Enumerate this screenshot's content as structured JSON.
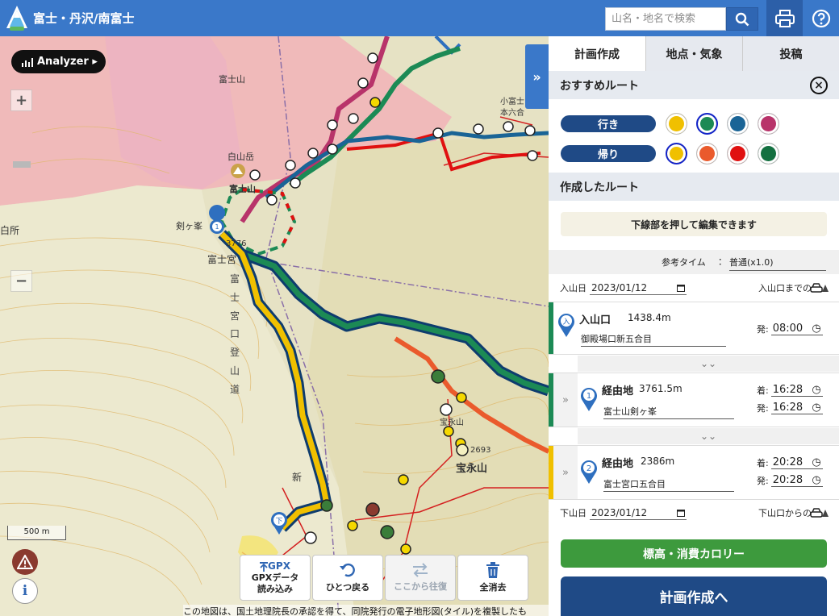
{
  "header": {
    "title": "富士・丹沢/南富士",
    "search_placeholder": "山名・地名で検索",
    "logo_icon": "mountain-logo-icon",
    "search_icon": "search-icon",
    "print_icon": "printer-icon",
    "help_icon": "help-icon",
    "color": "#3a78c9"
  },
  "map": {
    "analyzer_label": "Analyzer ▸",
    "zoom_in": "+",
    "zoom_out": "−",
    "scale": "500 m",
    "info_label": "i",
    "collapse_label": "»",
    "labels": {
      "fuji_1": "富士山",
      "fuji_2": "富士山",
      "hakusan": "白山岳",
      "kengamine": "剣ヶ峯",
      "elev_3776": "3776",
      "fujinomiya": "富士宮",
      "shirasho": "白所",
      "hoeizan": "宝永山",
      "hoeizan_small": "宝永山",
      "elev_2693": "2693",
      "motorokugo": "本六合",
      "kofuji": "小富士",
      "trail_vertical": "富士宮口登山道",
      "trail_tail": "新"
    },
    "toolbar": [
      {
        "icon": "upload-icon",
        "top": "GPX",
        "label": "GPXデータ\n読み込み",
        "enabled": true
      },
      {
        "icon": "undo-icon",
        "label": "ひとつ戻る",
        "enabled": true
      },
      {
        "icon": "swap-icon",
        "label": "ここから往復",
        "enabled": false
      },
      {
        "icon": "trash-icon",
        "label": "全消去",
        "enabled": true
      }
    ],
    "copyright": "この地図は、国土地理院長の承認を得て、同院発行の電子地形図(タイル)を複製したも"
  },
  "panel": {
    "tabs": [
      "計画作成",
      "地点・気象",
      "投稿"
    ],
    "active_tab": 0,
    "recommended": {
      "title": "おすすめルート",
      "outbound_label": "行き",
      "return_label": "帰り",
      "outbound_colors": [
        "#f0c000",
        "#1c8a55",
        "#1a6496",
        "#b8336a"
      ],
      "return_colors": [
        "#f0c000",
        "#ea5a2c",
        "#e01010",
        "#137040"
      ],
      "outbound_selected": 1,
      "return_selected": 0
    },
    "created": {
      "title": "作成したルート",
      "hint": "下線部を押して編集できます",
      "ref_time_label": "参考タイム",
      "ref_time_sep": "：",
      "ref_time_value": "普通(x1.0)"
    },
    "start_date": {
      "label": "入山日",
      "value": "2023/01/12",
      "access": "入山口までの"
    },
    "end_date": {
      "label": "下山日",
      "value": "2023/01/12",
      "access": "下山口からの"
    },
    "points": [
      {
        "badge": "入",
        "name": "入山口",
        "elev": "1438.4m",
        "place": "御殿場口新五合目",
        "depart_label": "発:",
        "depart": "08:00",
        "bar": "#1c8a55"
      },
      {
        "badge": "1",
        "name": "経由地",
        "elev": "3761.5m",
        "place": "富士山剣ヶ峯",
        "arrive_label": "着:",
        "arrive": "16:28",
        "depart_label": "発:",
        "depart": "16:28",
        "bar": "#1c8a55"
      },
      {
        "badge": "2",
        "name": "経由地",
        "elev": "2386m",
        "place": "富士宮口五合目",
        "arrive_label": "着:",
        "arrive": "20:28",
        "depart_label": "発:",
        "depart": "20:28",
        "bar": "#f0c000"
      }
    ],
    "move_icon": "chevron-double-right-icon",
    "chevron": "⌄⌄",
    "elevation_button": "標高・消費カロリー",
    "plan_button": "計画作成へ"
  }
}
